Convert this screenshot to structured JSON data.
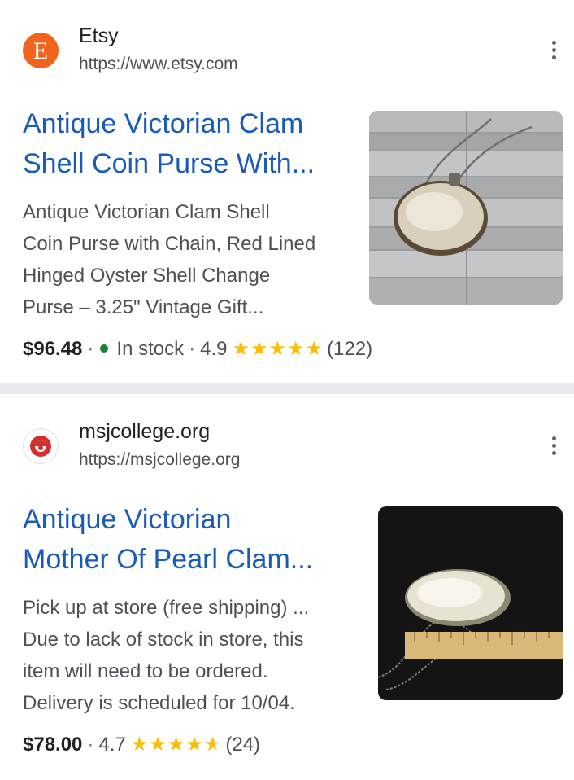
{
  "results": [
    {
      "favicon": "etsy-logo",
      "favicon_letter": "E",
      "site_name": "Etsy",
      "site_url": "https://www.etsy.com",
      "title_line1": "Antique Victorian Clam",
      "title_line2": "Shell Coin Purse With...",
      "snippet_lines": [
        "Antique Victorian Clam Shell",
        "Coin Purse with Chain, Red Lined",
        "Hinged Oyster Shell Change",
        "Purse – 3.25\" Vintage Gift..."
      ],
      "price": "$96.48",
      "availability": "In stock",
      "rating": "4.9",
      "stars": "★★★★★",
      "rating_value": 4.9,
      "reviews": "(122)",
      "thumbnail": "shell-purse-on-wood-photo"
    },
    {
      "favicon": "msjcollege-logo",
      "site_name": "msjcollege.org",
      "site_url": "https://msjcollege.org",
      "title_line1": "Antique Victorian",
      "title_line2": "Mother Of Pearl Clam...",
      "snippet_lines": [
        "Pick up at store (free shipping) ...",
        "Due to lack of stock in store, this",
        "item will need to be ordered.",
        "Delivery is scheduled for 10/04."
      ],
      "price": "$78.00",
      "rating": "4.7",
      "stars": "★★★★",
      "rating_value": 4.7,
      "reviews": "(24)",
      "thumbnail": "pearl-shell-with-ruler-photo"
    }
  ],
  "separator": "·",
  "colors": {
    "link": "#1a5bb5",
    "star": "#fbbc04",
    "in_stock": "#188038",
    "etsy_orange": "#f1641e"
  }
}
